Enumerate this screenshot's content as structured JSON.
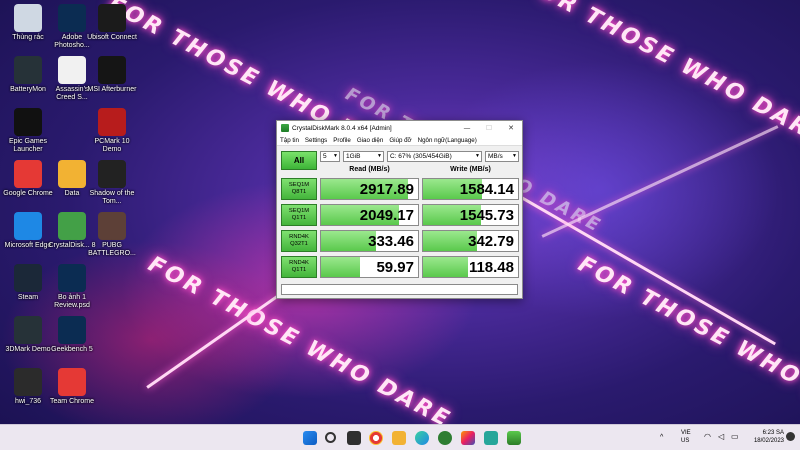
{
  "desktop": {
    "icons": [
      {
        "label": "Thùng rác",
        "color": "#cfd8e3"
      },
      {
        "label": "Adobe Photosho...",
        "color": "#0b2c52"
      },
      {
        "label": "Ubisoft Connect",
        "color": "#1b1b1b"
      },
      {
        "label": "BatteryMon",
        "color": "#263238"
      },
      {
        "label": "Assassin's Creed S...",
        "color": "#f1f1f1"
      },
      {
        "label": "MSI Afterburner",
        "color": "#151515"
      },
      {
        "label": "Epic Games Launcher",
        "color": "#111111"
      },
      {
        "label": "PCMark 10 Demo",
        "color": "#b71c1c"
      },
      {
        "label": "Google Chrome",
        "color": "#e53935"
      },
      {
        "label": "Data",
        "color": "#f2b233"
      },
      {
        "label": "Shadow of the Tom...",
        "color": "#222222"
      },
      {
        "label": "Microsoft Edge",
        "color": "#1e88e5"
      },
      {
        "label": "CrystalDisk... 8",
        "color": "#43a047"
      },
      {
        "label": "PUBG BATTLEGRO...",
        "color": "#5d4037"
      },
      {
        "label": "Steam",
        "color": "#1b2838"
      },
      {
        "label": "Bo ảnh 1 Review.psd",
        "color": "#0b2c52"
      },
      {
        "label": "3DMark Demo",
        "color": "#263238"
      },
      {
        "label": "Geekbench 5",
        "color": "#0b2c52"
      },
      {
        "label": "hwi_736",
        "color": "#2b2b2b"
      },
      {
        "label": "Team Chrome",
        "color": "#e53935"
      }
    ],
    "wallpaper_text": [
      "FOR THOSE WHO DARE",
      "FOR THOSE WHO DARE",
      "FOR THOSE WHO DARE",
      "FOR THOSE WHO DARE",
      "FOR THOSE WHO DARE"
    ]
  },
  "window": {
    "title": "CrystalDiskMark 8.0.4 x64 [Admin]",
    "menu": [
      "Tập tin",
      "Settings",
      "Profile",
      "Giao diện",
      "Giúp đỡ",
      "Ngôn ngữ(Language)"
    ],
    "all_label": "All",
    "count": "5",
    "size": "1GiB",
    "drive": "C: 67% (305/454GiB)",
    "unit": "MB/s",
    "read_header": "Read (MB/s)",
    "write_header": "Write (MB/s)",
    "tests": [
      {
        "line1": "SEQ1M",
        "line2": "Q8T1",
        "read": "2917.89",
        "write": "1584.14",
        "read_fill": 0.9,
        "write_fill": 0.62
      },
      {
        "line1": "SEQ1M",
        "line2": "Q1T1",
        "read": "2049.17",
        "write": "1545.73",
        "read_fill": 0.8,
        "write_fill": 0.61
      },
      {
        "line1": "RND4K",
        "line2": "Q32T1",
        "read": "333.46",
        "write": "342.79",
        "read_fill": 0.57,
        "write_fill": 0.57
      },
      {
        "line1": "RND4K",
        "line2": "Q1T1",
        "read": "59.97",
        "write": "118.48",
        "read_fill": 0.4,
        "write_fill": 0.47
      }
    ],
    "controls": {
      "minimize": "—",
      "maximize": "☐",
      "close": "✕"
    }
  },
  "taskbar": {
    "apps": [
      "windows-logo",
      "search",
      "task-view",
      "widgets",
      "chrome",
      "file-explorer",
      "edge",
      "xbox",
      "paint",
      "capture",
      "crystaldiskmark"
    ],
    "lang_top": "VIE",
    "lang_bottom": "US",
    "time": "6:23 SA",
    "date": "18/02/2023"
  }
}
